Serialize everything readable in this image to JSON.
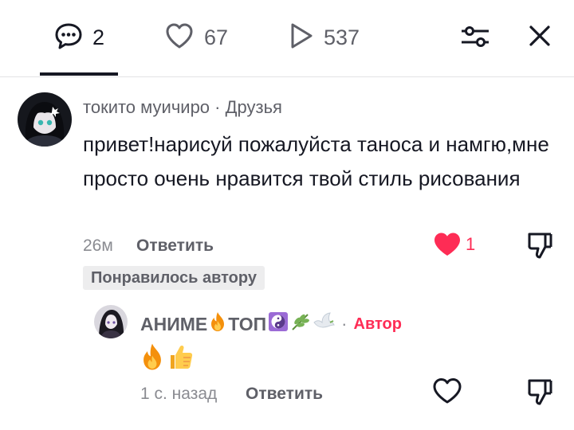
{
  "tabs": {
    "comments_count": "2",
    "likes_count": "67",
    "plays_count": "537"
  },
  "comment": {
    "username": "токито муичиро",
    "separator": "·",
    "relation": "Друзья",
    "text": "привет!нарисуй пожалуйста таноса и намгю,мне просто очень нравится твой стиль рисования",
    "time": "26м",
    "reply_label": "Ответить",
    "like_count": "1",
    "creator_liked_badge": "Понравилось автору"
  },
  "reply": {
    "username_text_1": "АНИМЕ",
    "username_text_2": "ТОП",
    "separator": "·",
    "author_tag": "Автор",
    "time": "1 с. назад",
    "reply_label": "Ответить"
  },
  "colors": {
    "accent": "#fe2c55",
    "text_primary": "#161823",
    "text_secondary": "#8a8b91",
    "badge_bg": "#ededee"
  }
}
